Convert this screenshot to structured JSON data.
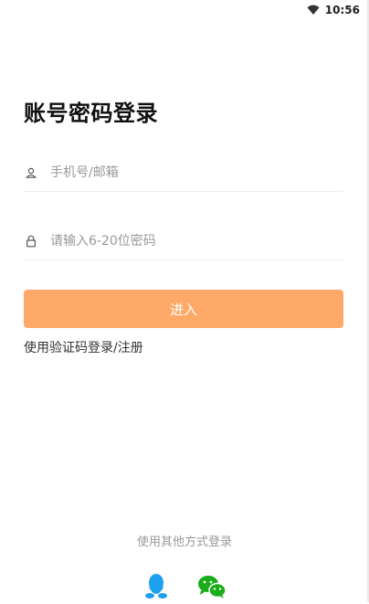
{
  "status_bar": {
    "time": "10:56",
    "wifi_icon": "wifi-icon"
  },
  "login": {
    "title": "账号密码登录",
    "account_placeholder": "手机号/邮箱",
    "account_icon": "user-icon",
    "password_placeholder": "请输入6-20位密码",
    "password_icon": "lock-icon",
    "enter_label": "进入",
    "sms_link": "使用验证码登录/注册"
  },
  "other_login": {
    "label": "使用其他方式登录",
    "providers": [
      "qq-icon",
      "wechat-icon"
    ]
  },
  "colors": {
    "primary_button": "#ffa968",
    "qq": "#1ea0f1",
    "wechat": "#1aad19"
  }
}
